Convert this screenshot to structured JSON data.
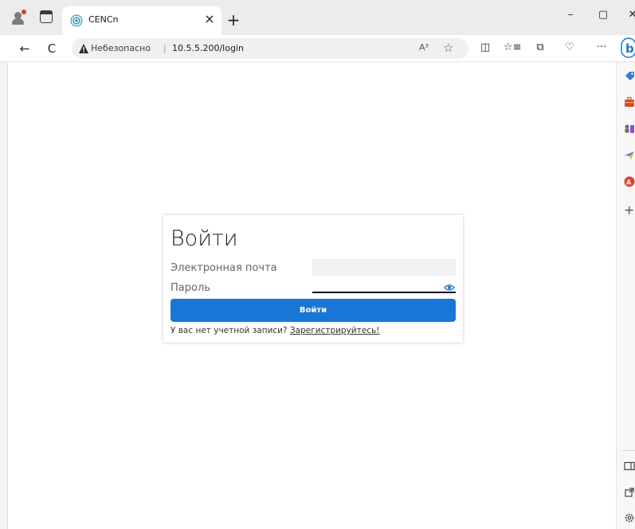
{
  "browser": {
    "tab_title": "CENCn",
    "tab_close": "×",
    "new_tab": "+",
    "window": {
      "minimize": "–",
      "maximize": "▢",
      "close": "✕"
    },
    "nav": {
      "back": "←",
      "reload": "C"
    },
    "address": {
      "security_label": "Небезопасно",
      "separator": "|",
      "url": "10.5.5.200/login",
      "read_aloud": "A³",
      "favorite": "☆"
    },
    "toolbar_icons": {
      "split": "◫",
      "favorites": "☆≡",
      "collections": "⧉",
      "performance": "♡",
      "more": "···"
    },
    "sidebar": {
      "add": "+"
    }
  },
  "login": {
    "heading": "Войти",
    "email_label": "Электронная почта",
    "password_label": "Пароль",
    "submit_label": "Войти",
    "register_prompt": "У вас нет учетной записи?",
    "register_link": "Зарегистрируйтесь!"
  },
  "colors": {
    "accent": "#1877d6",
    "tab_bg": "#ececec",
    "warning": "#2b2b2b"
  }
}
